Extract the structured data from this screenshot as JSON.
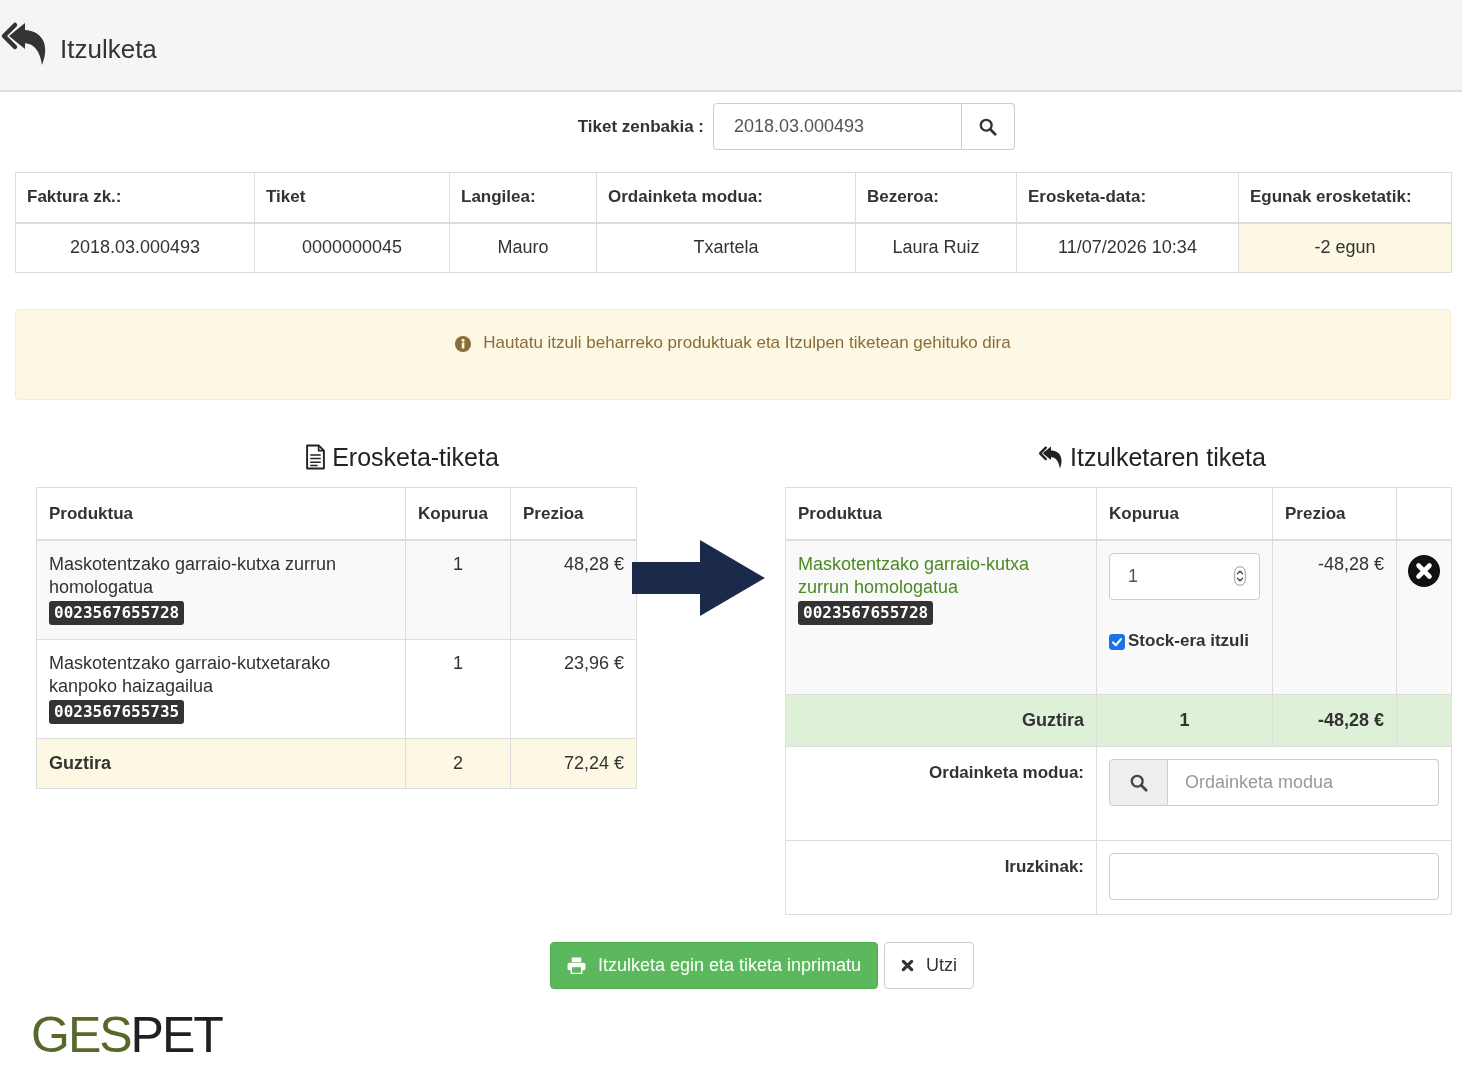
{
  "header": {
    "title": "Itzulketa"
  },
  "ticket_search": {
    "label": "Tiket zenbakia :",
    "value": "2018.03.000493"
  },
  "info_table": {
    "columns": [
      "Faktura zk.:",
      "Tiket",
      "Langilea:",
      "Ordainketa modua:",
      "Bezeroa:",
      "Erosketa-data:",
      "Egunak erosketatik:"
    ],
    "rows": [
      {
        "cells": [
          {
            "text": "2018.03.000493",
            "highlighted": false
          },
          {
            "text": "0000000045",
            "highlighted": false
          },
          {
            "text": "Mauro",
            "highlighted": false
          },
          {
            "text": "Txartela",
            "highlighted": false
          },
          {
            "text": "Laura Ruiz",
            "highlighted": false
          },
          {
            "text": "11/07/2026 10:34",
            "highlighted": false
          },
          {
            "text": "-2 egun",
            "highlighted": true
          }
        ]
      }
    ]
  },
  "alert": {
    "text": "Hautatu itzuli beharreko produktuak eta Itzulpen tiketean gehituko dira"
  },
  "purchase_ticket": {
    "title": "Erosketa-tiketa",
    "columns": [
      "Produktua",
      "Kopurua",
      "Prezioa"
    ],
    "rows": [
      {
        "product": "Maskotentzako garraio-kutxa zurrun homologatua",
        "barcode": "0023567655728",
        "quantity": "1",
        "price": "48,28 €"
      },
      {
        "product": "Maskotentzako garraio-kutxetarako kanpoko haizagailua",
        "barcode": "0023567655735",
        "quantity": "1",
        "price": "23,96 €"
      }
    ],
    "total": {
      "label": "Guztira",
      "quantity": "2",
      "price": "72,24 €"
    }
  },
  "return_ticket": {
    "title": "Itzulketaren tiketa",
    "columns": [
      "Produktua",
      "Kopurua",
      "Prezioa"
    ],
    "rows": [
      {
        "product": "Maskotentzako garraio-kutxa zurrun homologatua",
        "barcode": "0023567655728",
        "quantity": "1",
        "restock": {
          "label": "Stock-era itzuli",
          "checked": true
        },
        "price": "-48,28 €"
      }
    ],
    "total": {
      "label": "Guztira",
      "quantity": "1",
      "price": "-48,28 €"
    },
    "payment_method": {
      "label": "Ordainketa modua:",
      "placeholder": "Ordainketa modua"
    },
    "comments": {
      "label": "Iruzkinak:"
    }
  },
  "buttons": [
    {
      "kind": "primary",
      "label": "Itzulketa egin eta tiketa inprimatu"
    },
    {
      "kind": "default",
      "label": "Utzi"
    }
  ],
  "logo": [
    {
      "text": "GES",
      "color": "#56682a"
    },
    {
      "text": "PET",
      "color": "#231f20"
    }
  ]
}
